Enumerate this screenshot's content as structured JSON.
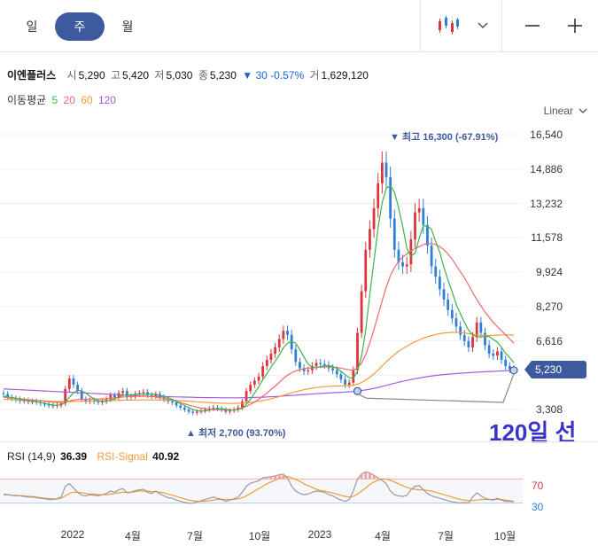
{
  "tabs": [
    {
      "label": "일",
      "active": false
    },
    {
      "label": "주",
      "active": true
    },
    {
      "label": "월",
      "active": false
    }
  ],
  "toolbar": {
    "chart_type_icon": "candlestick-icon",
    "dropdown_icon": "chevron-down-icon",
    "zoom_out_icon": "minus-icon",
    "zoom_in_icon": "plus-icon"
  },
  "quote": {
    "name": "이엔플러스",
    "open_label": "시",
    "open": "5,290",
    "high_label": "고",
    "high": "5,420",
    "low_label": "저",
    "low": "5,030",
    "close_label": "종",
    "close": "5,230",
    "change": "▼ 30 -0.57%",
    "volume_label": "거",
    "volume": "1,629,120"
  },
  "ma": {
    "label": "이동평균",
    "p5": "5",
    "p20": "20",
    "p60": "60",
    "p120": "120"
  },
  "scale": {
    "label": "Linear"
  },
  "price_tag": "5,230",
  "annotations": {
    "high": "▼ 최고 16,300 (-67.91%)",
    "low": "▲ 최저 2,700 (93.70%)",
    "callout": "120일 선"
  },
  "rsi": {
    "label": "RSI",
    "params": "(14,9)",
    "value": "36.39",
    "signal_label": "RSI-Signal",
    "signal_value": "40.92",
    "upper": "70",
    "lower": "30"
  },
  "colors": {
    "up": "#d9363e",
    "down": "#2f7fd6",
    "ma5": "#3cb34a",
    "ma20": "#ef6a6a",
    "ma60": "#f29b3a",
    "ma120": "#a35be0",
    "accent": "#3d5a9e",
    "callout": "#3a33c9"
  },
  "chart_data": {
    "type": "candlestick",
    "y_axis": {
      "ticks": [
        16540,
        14886,
        13232,
        11578,
        9924,
        8270,
        6616,
        4962,
        3308
      ],
      "tick_labels": [
        "16,540",
        "14,886",
        "13,232",
        "11,578",
        "9,924",
        "8,270",
        "6,616",
        "",
        "3,308"
      ],
      "range": [
        1800,
        17200
      ],
      "scale": "linear"
    },
    "x_axis": {
      "tick_labels": [
        "2022",
        "4월",
        "7월",
        "10월",
        "2023",
        "4월",
        "7월",
        "10월"
      ]
    },
    "high": {
      "value": 16300,
      "label": "최고 16,300 (-67.91%)"
    },
    "low": {
      "value": 2700,
      "label": "최저 2,700 (93.70%)"
    },
    "last_close": 5230,
    "series_close": [
      4050,
      3900,
      3850,
      3800,
      3720,
      3750,
      3680,
      3700,
      3650,
      3600,
      3550,
      3500,
      3480,
      3520,
      3600,
      4300,
      4800,
      4500,
      4200,
      3800,
      3700,
      3750,
      3680,
      3650,
      3700,
      3800,
      4000,
      3900,
      4100,
      4200,
      3900,
      3950,
      4050,
      4100,
      4150,
      4000,
      3950,
      4050,
      3900,
      3800,
      3700,
      3650,
      3500,
      3400,
      3300,
      3200,
      3150,
      3200,
      3250,
      3300,
      3350,
      3400,
      3350,
      3300,
      3200,
      3250,
      3300,
      3400,
      3700,
      4200,
      4500,
      4700,
      4900,
      5400,
      5700,
      6000,
      6300,
      6700,
      7100,
      6900,
      6200,
      5600,
      5300,
      5150,
      5200,
      5400,
      5550,
      5500,
      5450,
      5300,
      5200,
      5000,
      4750,
      4500,
      4600,
      5200,
      7000,
      9000,
      11000,
      12000,
      13000,
      14200,
      15200,
      14500,
      12500,
      11000,
      10400,
      10200,
      10300,
      11500,
      12800,
      13000,
      12200,
      11200,
      10200,
      9700,
      9100,
      8600,
      8100,
      7700,
      7300,
      6900,
      6600,
      6300,
      6800,
      7500,
      7000,
      6400,
      6000,
      5900,
      6100,
      5700,
      5400,
      5260,
      5230
    ],
    "ma5": [
      3950,
      3920,
      3880,
      3850,
      3800,
      3760,
      3720,
      3700,
      3680,
      3640,
      3600,
      3560,
      3520,
      3510,
      3530,
      3650,
      3900,
      4100,
      4250,
      4200,
      4100,
      3950,
      3820,
      3720,
      3700,
      3700,
      3760,
      3820,
      3900,
      4000,
      4020,
      4000,
      4040,
      4060,
      4050,
      4050,
      4050,
      4040,
      4000,
      3940,
      3870,
      3800,
      3700,
      3590,
      3500,
      3400,
      3310,
      3250,
      3230,
      3240,
      3280,
      3320,
      3340,
      3350,
      3320,
      3290,
      3280,
      3300,
      3380,
      3560,
      3800,
      4100,
      4400,
      4740,
      5040,
      5340,
      5630,
      5930,
      6280,
      6500,
      6580,
      6500,
      6180,
      5840,
      5500,
      5350,
      5330,
      5370,
      5420,
      5420,
      5380,
      5290,
      5150,
      4990,
      4840,
      4800,
      5160,
      5880,
      7120,
      8840,
      10440,
      12040,
      13280,
      13960,
      14080,
      13780,
      13020,
      12120,
      11080,
      10680,
      10840,
      11560,
      12160,
      12140,
      11980,
      11400,
      10880,
      10160,
      9540,
      8980,
      8360,
      7920,
      7500,
      7130,
      6900,
      6800,
      6800,
      6830,
      6820,
      6680,
      6550,
      6300,
      6020,
      5800,
      5560
    ],
    "ma20": [
      3900,
      3880,
      3860,
      3840,
      3820,
      3800,
      3780,
      3760,
      3740,
      3720,
      3700,
      3680,
      3660,
      3650,
      3650,
      3680,
      3720,
      3760,
      3790,
      3800,
      3800,
      3810,
      3810,
      3810,
      3820,
      3830,
      3850,
      3870,
      3890,
      3910,
      3920,
      3930,
      3940,
      3950,
      3950,
      3940,
      3930,
      3910,
      3880,
      3850,
      3800,
      3750,
      3700,
      3640,
      3580,
      3520,
      3470,
      3420,
      3380,
      3350,
      3330,
      3310,
      3300,
      3290,
      3280,
      3280,
      3290,
      3320,
      3380,
      3460,
      3560,
      3670,
      3800,
      3950,
      4100,
      4270,
      4440,
      4620,
      4800,
      4960,
      5080,
      5170,
      5230,
      5270,
      5300,
      5320,
      5340,
      5350,
      5360,
      5360,
      5350,
      5330,
      5300,
      5260,
      5220,
      5200,
      5300,
      5550,
      5950,
      6500,
      7150,
      7850,
      8550,
      9200,
      9750,
      10150,
      10450,
      10650,
      10800,
      10950,
      11050,
      11150,
      11250,
      11300,
      11300,
      11250,
      11150,
      11000,
      10800,
      10550,
      10250,
      9950,
      9650,
      9300,
      8950,
      8600,
      8300,
      8000,
      7750,
      7500,
      7300,
      7100,
      6900,
      6700,
      6500
    ],
    "ma60": [
      3800,
      3790,
      3780,
      3770,
      3760,
      3750,
      3745,
      3740,
      3735,
      3730,
      3720,
      3710,
      3700,
      3695,
      3690,
      3690,
      3690,
      3695,
      3700,
      3705,
      3710,
      3715,
      3720,
      3725,
      3730,
      3735,
      3740,
      3745,
      3750,
      3755,
      3760,
      3762,
      3764,
      3766,
      3768,
      3770,
      3770,
      3768,
      3765,
      3760,
      3755,
      3748,
      3740,
      3730,
      3720,
      3708,
      3695,
      3680,
      3665,
      3650,
      3640,
      3630,
      3620,
      3612,
      3605,
      3600,
      3600,
      3605,
      3615,
      3630,
      3650,
      3675,
      3705,
      3740,
      3780,
      3825,
      3875,
      3930,
      3990,
      4050,
      4110,
      4165,
      4215,
      4260,
      4300,
      4335,
      4365,
      4390,
      4410,
      4425,
      4435,
      4440,
      4445,
      4450,
      4460,
      4480,
      4530,
      4610,
      4720,
      4860,
      5020,
      5200,
      5400,
      5600,
      5790,
      5960,
      6110,
      6240,
      6360,
      6470,
      6570,
      6660,
      6740,
      6810,
      6870,
      6920,
      6960,
      6990,
      7010,
      7020,
      7020,
      7010,
      6990,
      6960,
      6930,
      6900,
      6880,
      6870,
      6870,
      6880,
      6890,
      6900,
      6900,
      6900,
      6890
    ],
    "ma120": [
      4300,
      4290,
      4280,
      4270,
      4260,
      4250,
      4240,
      4230,
      4220,
      4210,
      4200,
      4190,
      4180,
      4170,
      4160,
      4150,
      4140,
      4130,
      4120,
      4110,
      4100,
      4090,
      4080,
      4070,
      4060,
      4050,
      4040,
      4030,
      4020,
      4010,
      4000,
      3990,
      3980,
      3970,
      3960,
      3950,
      3945,
      3940,
      3935,
      3930,
      3925,
      3920,
      3915,
      3910,
      3905,
      3900,
      3895,
      3890,
      3885,
      3880,
      3878,
      3876,
      3874,
      3872,
      3870,
      3870,
      3870,
      3872,
      3874,
      3878,
      3882,
      3888,
      3895,
      3903,
      3912,
      3922,
      3933,
      3945,
      3958,
      3972,
      3986,
      4000,
      4014,
      4028,
      4042,
      4055,
      4068,
      4080,
      4092,
      4104,
      4115,
      4126,
      4137,
      4148,
      4160,
      4175,
      4195,
      4220,
      4250,
      4285,
      4325,
      4370,
      4420,
      4470,
      4520,
      4570,
      4620,
      4665,
      4710,
      4750,
      4790,
      4825,
      4860,
      4890,
      4920,
      4945,
      4970,
      4990,
      5010,
      5025,
      5040,
      5055,
      5068,
      5080,
      5092,
      5104,
      5115,
      5125,
      5135,
      5145,
      5155,
      5165,
      5175,
      5185,
      5195
    ],
    "rsi": [
      45,
      44,
      43,
      42,
      42,
      41,
      40,
      40,
      39,
      38,
      37,
      36,
      36,
      37,
      40,
      58,
      62,
      55,
      48,
      43,
      42,
      44,
      43,
      42,
      44,
      46,
      50,
      48,
      52,
      54,
      47,
      48,
      51,
      52,
      53,
      48,
      46,
      50,
      45,
      42,
      39,
      38,
      35,
      33,
      31,
      30,
      30,
      32,
      34,
      36,
      38,
      40,
      38,
      36,
      33,
      35,
      37,
      40,
      48,
      58,
      63,
      65,
      67,
      72,
      73,
      74,
      75,
      77,
      78,
      72,
      58,
      50,
      46,
      44,
      45,
      48,
      50,
      49,
      48,
      44,
      42,
      38,
      35,
      33,
      36,
      50,
      70,
      78,
      82,
      80,
      76,
      72,
      68,
      62,
      50,
      44,
      42,
      41,
      43,
      52,
      58,
      59,
      52,
      46,
      42,
      40,
      38,
      36,
      34,
      32,
      31,
      30,
      31,
      30,
      40,
      47,
      42,
      38,
      36,
      35,
      38,
      35,
      33,
      33,
      32
    ],
    "rsi_signal": [
      44,
      44,
      43,
      43,
      42,
      42,
      41,
      41,
      40,
      39,
      38,
      38,
      37,
      37,
      38,
      42,
      46,
      48,
      48,
      47,
      46,
      45,
      45,
      44,
      44,
      44,
      45,
      46,
      47,
      48,
      48,
      48,
      49,
      50,
      50,
      50,
      49,
      49,
      48,
      47,
      45,
      43,
      41,
      39,
      37,
      35,
      34,
      33,
      33,
      33,
      34,
      35,
      36,
      36,
      36,
      36,
      36,
      37,
      39,
      42,
      46,
      50,
      54,
      58,
      62,
      65,
      68,
      71,
      73,
      74,
      72,
      69,
      66,
      62,
      59,
      56,
      53,
      51,
      50,
      48,
      47,
      45,
      43,
      41,
      40,
      41,
      45,
      50,
      55,
      61,
      65,
      68,
      70,
      70,
      68,
      65,
      62,
      59,
      56,
      54,
      53,
      52,
      52,
      51,
      50,
      48,
      46,
      44,
      42,
      40,
      38,
      36,
      35,
      34,
      34,
      35,
      36,
      36,
      36,
      36,
      36,
      36,
      35,
      34,
      33
    ]
  }
}
